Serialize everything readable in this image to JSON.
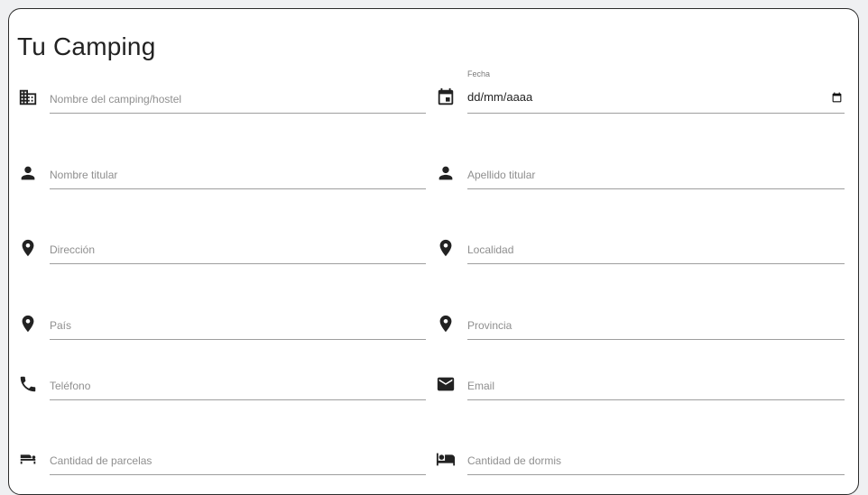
{
  "title": "Tu Camping",
  "fields": {
    "nombre_camping": {
      "placeholder": "Nombre del camping/hostel",
      "icon": "building-icon"
    },
    "fecha": {
      "label": "Fecha",
      "value": "dd/mm/aaaa",
      "icon": "calendar-icon"
    },
    "nombre_titular": {
      "placeholder": "Nombre titular",
      "icon": "person-icon"
    },
    "apellido_titular": {
      "placeholder": "Apellido titular",
      "icon": "person-icon"
    },
    "direccion": {
      "placeholder": "Dirección",
      "icon": "location-pin-icon"
    },
    "localidad": {
      "placeholder": "Localidad",
      "icon": "location-pin-icon"
    },
    "pais": {
      "placeholder": "País",
      "icon": "location-pin-icon"
    },
    "provincia": {
      "placeholder": "Provincia",
      "icon": "location-pin-icon"
    },
    "telefono": {
      "placeholder": "Teléfono",
      "icon": "phone-icon"
    },
    "email": {
      "placeholder": "Email",
      "icon": "mail-icon"
    },
    "cantidad_parcelas": {
      "placeholder": "Cantidad de parcelas",
      "icon": "tent-icon"
    },
    "cantidad_dormis": {
      "placeholder": "Cantidad de dormis",
      "icon": "bed-icon"
    }
  }
}
